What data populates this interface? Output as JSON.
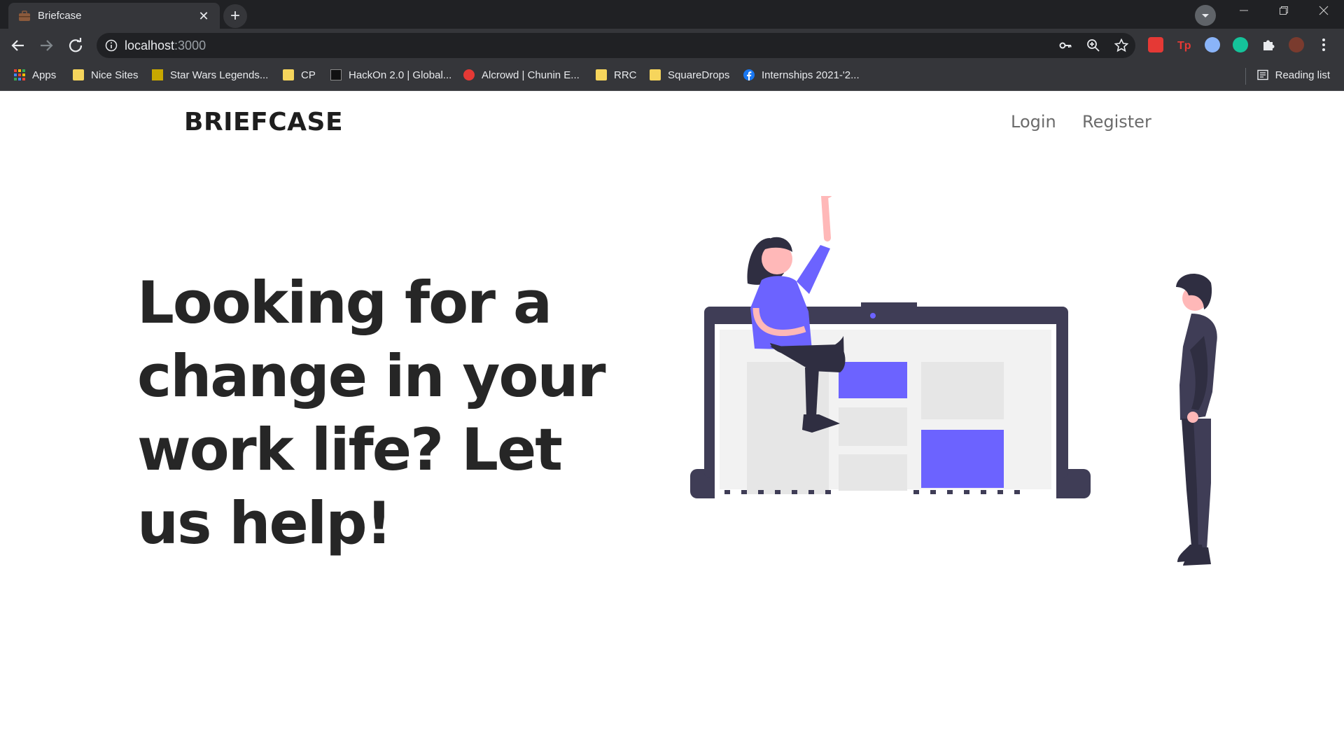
{
  "browser": {
    "tab": {
      "title": "Briefcase",
      "close": "✕"
    },
    "new_tab": "+",
    "address": {
      "host": "localhost",
      "port": ":3000"
    },
    "bookmarks": [
      {
        "label": "Apps",
        "icon": "apps-grid-icon"
      },
      {
        "label": "Nice Sites",
        "icon": "folder-icon"
      },
      {
        "label": "Star Wars Legends...",
        "icon": "starwars-icon"
      },
      {
        "label": "CP",
        "icon": "folder-icon"
      },
      {
        "label": "HackOn 2.0 | Global...",
        "icon": "hackon-icon"
      },
      {
        "label": "Alcrowd | Chunin E...",
        "icon": "aicrowd-icon"
      },
      {
        "label": "RRC",
        "icon": "folder-icon"
      },
      {
        "label": "SquareDrops",
        "icon": "folder-icon"
      },
      {
        "label": "Internships 2021-'2...",
        "icon": "facebook-icon"
      }
    ],
    "reading_list": "Reading list"
  },
  "site": {
    "brand": "BRIEFCASE",
    "nav": {
      "login": "Login",
      "register": "Register"
    },
    "hero_heading": "Looking for a change in your work life? Let us help!"
  },
  "colors": {
    "accent": "#6c63ff",
    "dark": "#3f3d56",
    "skin": "#ffb8b8"
  }
}
